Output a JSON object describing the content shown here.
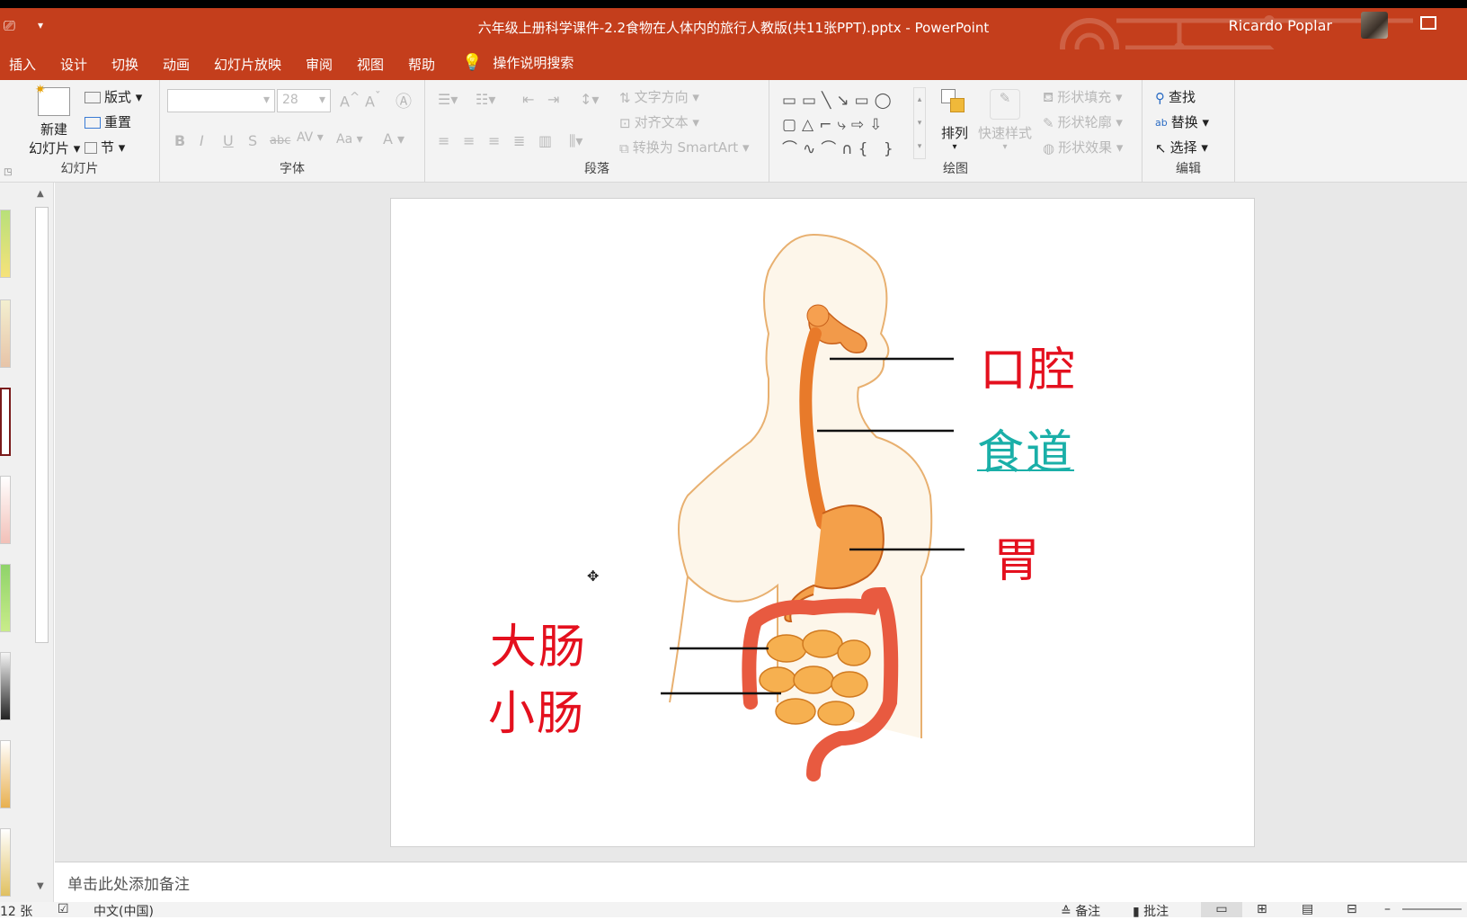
{
  "window": {
    "title": "六年级上册科学课件-2.2食物在人体内的旅行人教版(共11张PPT).pptx  -  PowerPoint",
    "user": "Ricardo Poplar"
  },
  "menu": {
    "items": [
      "插入",
      "设计",
      "切换",
      "动画",
      "幻灯片放映",
      "审阅",
      "视图",
      "帮助"
    ],
    "search": "操作说明搜索"
  },
  "ribbon": {
    "slides": {
      "new_slide_line1": "新建",
      "new_slide_line2": "幻灯片",
      "layout": "版式",
      "reset": "重置",
      "section": "节",
      "label": "幻灯片"
    },
    "font": {
      "size": "28",
      "label": "字体"
    },
    "paragraph": {
      "text_direction": "文字方向",
      "align_text": "对齐文本",
      "smartart": "转换为 SmartArt",
      "label": "段落"
    },
    "drawing": {
      "arrange": "排列",
      "quick_styles": "快速样式",
      "shape_fill": "形状填充",
      "shape_outline": "形状轮廓",
      "shape_effects": "形状效果",
      "label": "绘图"
    },
    "editing": {
      "find": "查找",
      "replace": "替换",
      "select": "选择",
      "label": "编辑"
    }
  },
  "slide": {
    "labels": {
      "mouth": "口腔",
      "esophagus": "食道",
      "stomach": "胃",
      "large_intestine": "大肠",
      "small_intestine": "小肠"
    }
  },
  "notes": {
    "placeholder": "单击此处添加备注"
  },
  "status": {
    "slide_count": "12 张",
    "language": "中文(中国)",
    "notes": "备注",
    "comments": "批注"
  },
  "colors": {
    "accent": "#c43e1c",
    "label_red": "#e4101e",
    "label_teal": "#1aafa8"
  }
}
